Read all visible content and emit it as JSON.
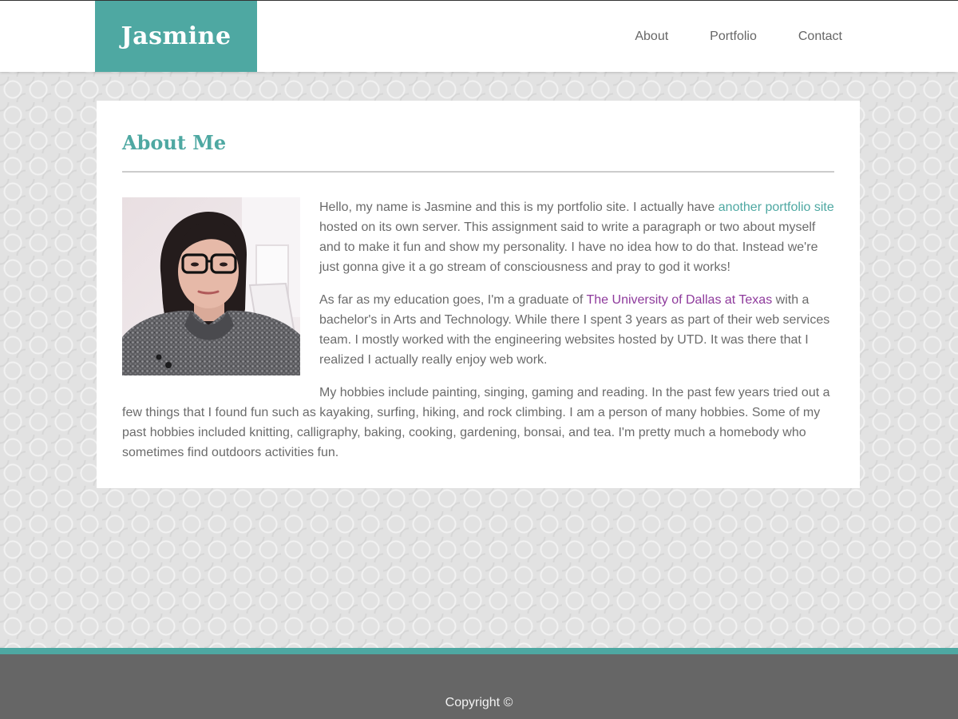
{
  "header": {
    "logo": "Jasmine",
    "nav": [
      {
        "label": "About"
      },
      {
        "label": "Portfolio"
      },
      {
        "label": "Contact"
      }
    ]
  },
  "main": {
    "title": "About Me",
    "paragraphs": {
      "p1_before": "Hello, my name is Jasmine and this is my portfolio site. I actually have ",
      "p1_link": "another portfolio site",
      "p1_after": " hosted on its own server. This assignment said to write a paragraph or two about myself and to make it fun and show my personality. I have no idea how to do that. Instead we're just gonna give it a go stream of consciousness and pray to god it works!",
      "p2_before": "As far as my education goes, I'm a graduate of ",
      "p2_link": "The University of Dallas at Texas",
      "p2_after": " with a bachelor's in Arts and Technology. While there I spent 3 years as part of their web services team. I mostly worked with the engineering websites hosted by UTD. It was there that I realized I actually really enjoy web work.",
      "p3": "My hobbies include painting, singing, gaming and reading. In the past few years tried out a few things that I found fun such as kayaking, surfing, hiking, and rock climbing. I am a person of many hobbies. Some of my past hobbies included knitting, calligraphy, baking, cooking, gardening, bonsai, and tea. I'm pretty much a homebody who sometimes find outdoors activities fun."
    }
  },
  "footer": {
    "copyright": "Copyright ©"
  },
  "colors": {
    "accent": "#4ea8a2",
    "visited_link": "#8e3a9c",
    "footer_bg": "#666666"
  }
}
